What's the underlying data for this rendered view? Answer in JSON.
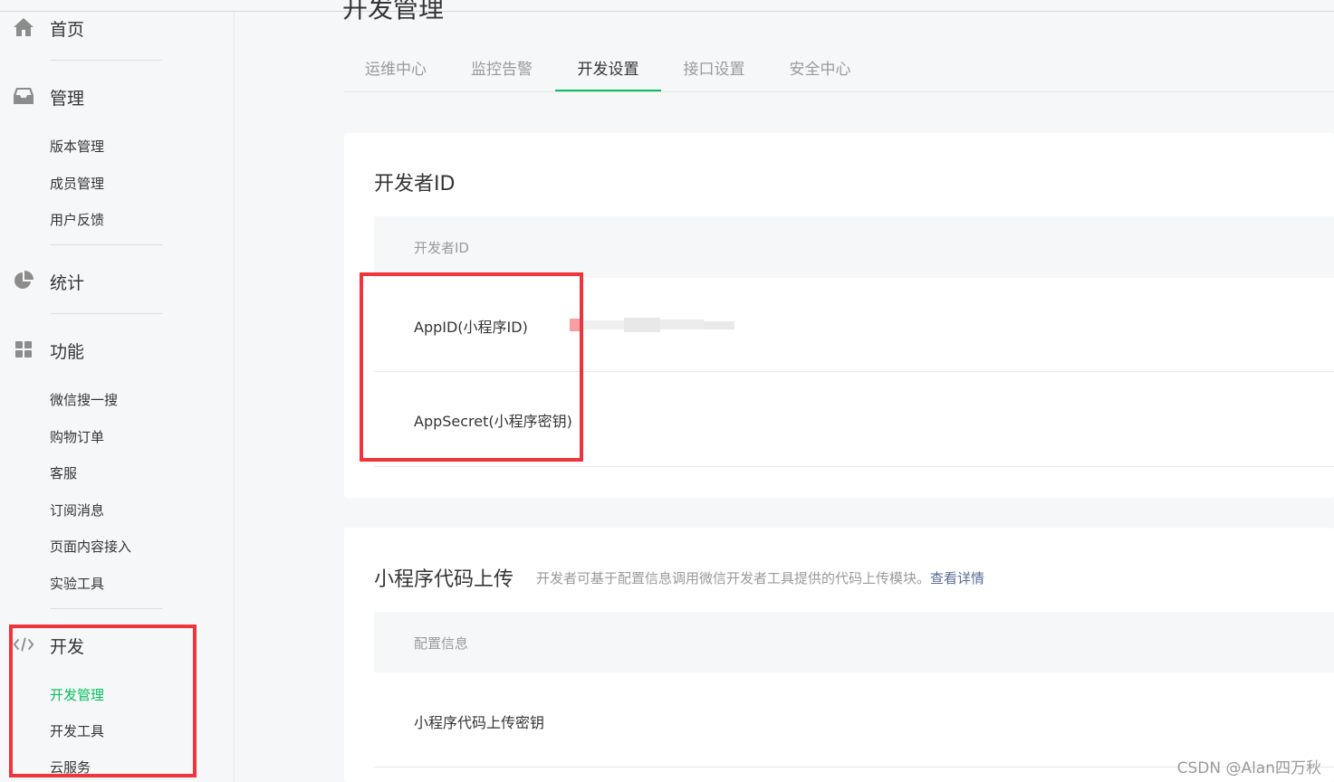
{
  "sidebar": {
    "home": {
      "label": "首页",
      "icon": "home-icon"
    },
    "manage": {
      "label": "管理",
      "icon": "inbox-icon",
      "items": [
        "版本管理",
        "成员管理",
        "用户反馈"
      ]
    },
    "stats": {
      "label": "统计",
      "icon": "pie-chart-icon"
    },
    "features": {
      "label": "功能",
      "icon": "grid-icon",
      "items": [
        "微信搜一搜",
        "购物订单",
        "客服",
        "订阅消息",
        "页面内容接入",
        "实验工具"
      ]
    },
    "dev": {
      "label": "开发",
      "icon": "code-icon",
      "items": [
        "开发管理",
        "开发工具",
        "云服务"
      ],
      "active_item": "开发管理"
    }
  },
  "main": {
    "page_title": "开发管理",
    "tabs": [
      "运维中心",
      "监控告警",
      "开发设置",
      "接口设置",
      "安全中心"
    ],
    "active_tab": "开发设置",
    "developer_id_card": {
      "title": "开发者ID",
      "table_header": "开发者ID",
      "rows": [
        {
          "label": "AppID(小程序ID)"
        },
        {
          "label": "AppSecret(小程序密钥)"
        }
      ]
    },
    "upload_card": {
      "title": "小程序代码上传",
      "description": "开发者可基于配置信息调用微信开发者工具提供的代码上传模块。",
      "link": "查看详情",
      "table_header": "配置信息",
      "rows": [
        {
          "label": "小程序代码上传密钥"
        }
      ]
    }
  },
  "colors": {
    "accent": "#07c160",
    "highlight": "#f0343b",
    "link": "#576b95"
  },
  "watermark": "CSDN @Alan四万秋"
}
